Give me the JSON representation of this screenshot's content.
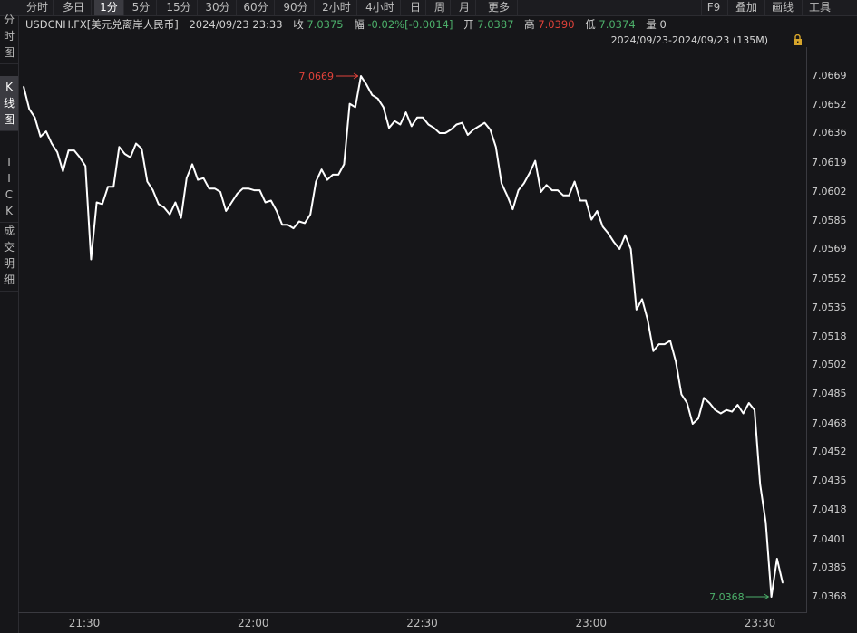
{
  "tabs": [
    "分时",
    "多日",
    "1分",
    "5分",
    "15分",
    "30分",
    "60分",
    "90分",
    "2小时",
    "4小时",
    "日",
    "周",
    "月",
    "更多"
  ],
  "active_tab": "1分",
  "tools": [
    "F9",
    "叠加",
    "画线",
    "工具"
  ],
  "side_tabs": [
    [
      "分",
      "时",
      "图"
    ],
    [
      "K",
      "线",
      "图"
    ],
    [
      "T",
      "I",
      "C",
      "K"
    ],
    [
      "成",
      "交",
      "明",
      "细"
    ]
  ],
  "active_side_tab": 1,
  "quote": {
    "symbol": "USDCNH.FX[美元兑离岸人民币]",
    "datetime": "2024/09/23 23:33",
    "close_label": "收",
    "close_value": "7.0375",
    "change_label": "幅",
    "change_value": "-0.02%[-0.0014]",
    "open_label": "开",
    "open_value": "7.0387",
    "high_label": "高",
    "high_value": "7.0390",
    "low_label": "低",
    "low_value": "7.0374",
    "volume_label": "量",
    "volume_value": "0"
  },
  "range_text": "2024/09/23-2024/09/23 (135M)",
  "colors": {
    "up": "#e0423a",
    "down": "#4caf6a",
    "line": "#ffffff",
    "background": "#161619"
  },
  "chart_data": {
    "type": "line",
    "y_ticks": [
      "7.0669",
      "7.0652",
      "7.0636",
      "7.0619",
      "7.0602",
      "7.0585",
      "7.0569",
      "7.0552",
      "7.0535",
      "7.0518",
      "7.0502",
      "7.0485",
      "7.0468",
      "7.0452",
      "7.0435",
      "7.0418",
      "7.0401",
      "7.0385",
      "7.0368"
    ],
    "x_ticks": [
      "21:30",
      "22:00",
      "22:30",
      "23:00",
      "23:30"
    ],
    "ylim": [
      7.0368,
      7.0669
    ],
    "max_label": "7.0669",
    "min_label": "7.0368",
    "values": [
      7.0663,
      7.065,
      7.0645,
      7.0634,
      7.0637,
      7.063,
      7.0625,
      7.0614,
      7.0626,
      7.0626,
      7.0622,
      7.0617,
      7.0563,
      7.0596,
      7.0595,
      7.0605,
      7.0605,
      7.0628,
      7.0624,
      7.0622,
      7.063,
      7.0627,
      7.0608,
      7.0603,
      7.0595,
      7.0593,
      7.0589,
      7.0596,
      7.0587,
      7.061,
      7.0618,
      7.0609,
      7.061,
      7.0604,
      7.0604,
      7.0602,
      7.0591,
      7.0596,
      7.0601,
      7.0604,
      7.0604,
      7.0603,
      7.0603,
      7.0596,
      7.0597,
      7.0591,
      7.0583,
      7.0583,
      7.0581,
      7.0585,
      7.0584,
      7.0589,
      7.0608,
      7.0615,
      7.0609,
      7.0612,
      7.0612,
      7.0618,
      7.0653,
      7.0651,
      7.0669,
      7.0664,
      7.0658,
      7.0656,
      7.0651,
      7.0639,
      7.0643,
      7.0641,
      7.0648,
      7.064,
      7.0645,
      7.0645,
      7.0641,
      7.0639,
      7.0636,
      7.0636,
      7.0638,
      7.0641,
      7.0642,
      7.0635,
      7.0638,
      7.064,
      7.0642,
      7.0638,
      7.0628,
      7.0607,
      7.06,
      7.0592,
      7.0603,
      7.0607,
      7.0613,
      7.062,
      7.0602,
      7.0606,
      7.0603,
      7.0603,
      7.06,
      7.06,
      7.0608,
      7.0597,
      7.0597,
      7.0586,
      7.0591,
      7.0582,
      7.0578,
      7.0573,
      7.0569,
      7.0577,
      7.0569,
      7.0534,
      7.054,
      7.0528,
      7.051,
      7.0514,
      7.0514,
      7.0516,
      7.0504,
      7.0485,
      7.048,
      7.0468,
      7.0471,
      7.0483,
      7.048,
      7.0476,
      7.0474,
      7.0476,
      7.0475,
      7.0479,
      7.0474,
      7.048,
      7.0476,
      7.0433,
      7.0411,
      7.0368,
      7.039,
      7.0376
    ]
  }
}
